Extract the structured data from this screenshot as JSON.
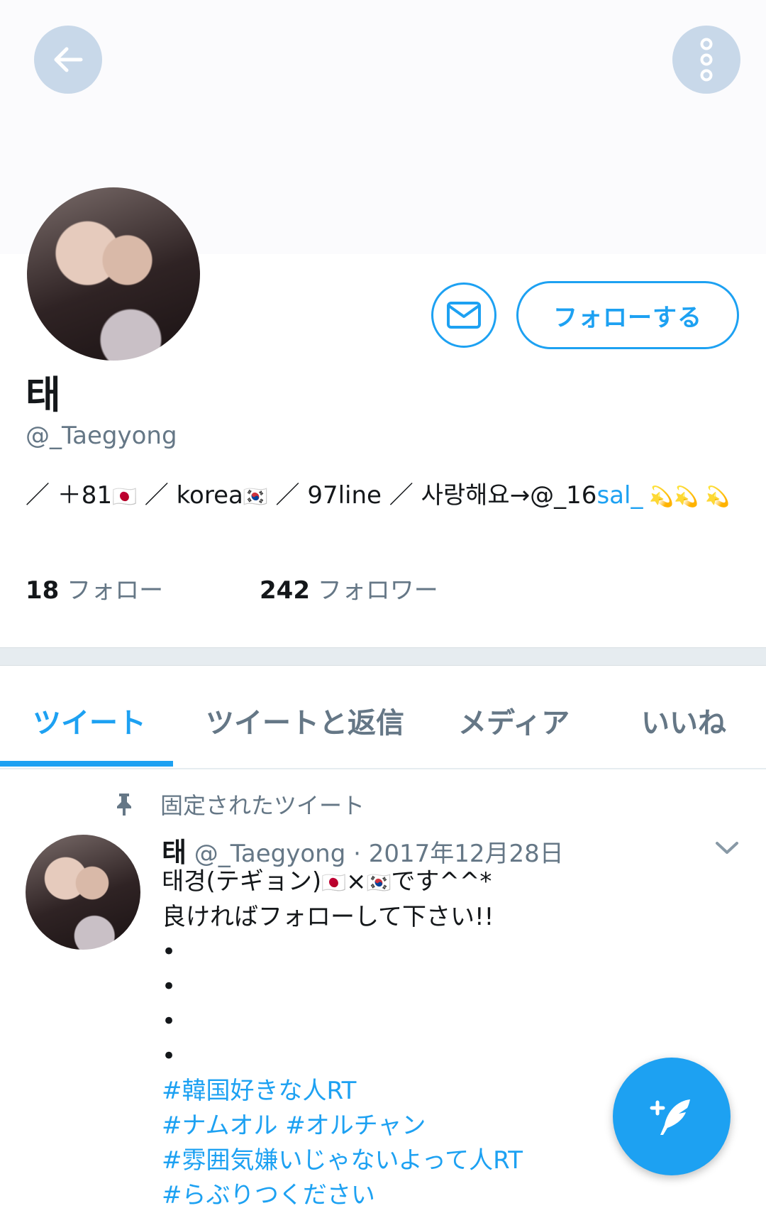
{
  "header": {
    "back_icon": "arrow-left-icon",
    "more_icon": "more-vertical-icon"
  },
  "profile": {
    "display_name": "태",
    "handle": "@_Taegyong",
    "message_icon": "mail-icon",
    "follow_label": "フォローする",
    "bio": {
      "seg1": "／ ＋81",
      "flag_jp": "🇯🇵",
      "seg2": " ／ korea",
      "flag_kr": "🇰🇷",
      "seg3": " ／ 97line ／ 사랑해요→@_16",
      "link": "sal_",
      "rings": " 💫💫 💫"
    },
    "following_count": "18",
    "following_label": "フォロー",
    "followers_count": "242",
    "followers_label": "フォロワー"
  },
  "tabs": [
    {
      "label": "ツイート",
      "active": true
    },
    {
      "label": "ツイートと返信",
      "active": false
    },
    {
      "label": "メディア",
      "active": false
    },
    {
      "label": "いいね",
      "active": false
    }
  ],
  "pinned_tweet": {
    "pinned_label": "固定されたツイート",
    "author_name": "태",
    "author_handle": "@_Taegyong",
    "separator": "·",
    "date": "2017年12月28日",
    "line1_a": "태경(テギョン)",
    "line1_flag_jp": "🇯🇵",
    "line1_x": "×",
    "line1_flag_kr": "🇰🇷",
    "line1_b": "です^^*",
    "line2": "良ければフォローして下さい!!",
    "bullets": [
      "•",
      "•",
      "•",
      "•"
    ],
    "hashtags": [
      "#韓国好きな人RT",
      "#ナムオル #オルチャン",
      "#雰囲気嫌いじゃないよって人RT",
      "#らぶりつください"
    ]
  },
  "fab": {
    "icon": "compose-tweet-icon"
  },
  "colors": {
    "accent": "#1da1f2",
    "muted": "#657786",
    "text": "#14171a",
    "header_button": "#c8d8e9"
  }
}
